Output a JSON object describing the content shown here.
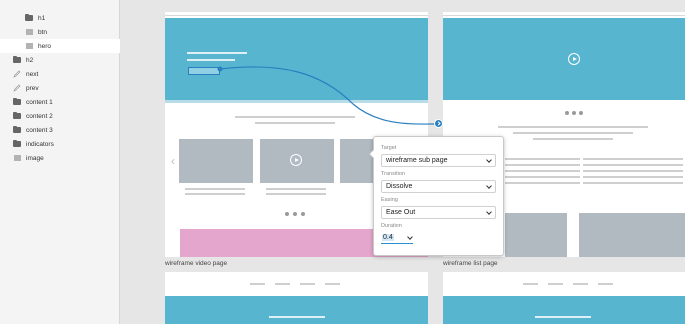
{
  "layers": [
    {
      "label": "h1",
      "icon": "folder-icon"
    },
    {
      "label": "btn",
      "icon": "rectangle-icon"
    },
    {
      "label": "hero",
      "icon": "rectangle-icon",
      "selected": true
    },
    {
      "label": "h2",
      "icon": "folder-icon"
    },
    {
      "label": "next",
      "icon": "pen-icon"
    },
    {
      "label": "prev",
      "icon": "pen-icon"
    },
    {
      "label": "content 1",
      "icon": "folder-icon"
    },
    {
      "label": "content 2",
      "icon": "folder-icon"
    },
    {
      "label": "content 3",
      "icon": "folder-icon"
    },
    {
      "label": "indicators",
      "icon": "folder-icon"
    },
    {
      "label": "image",
      "icon": "rectangle-icon"
    }
  ],
  "artboards": {
    "video_label": "wireframe video page",
    "list_label": "wireframe list page",
    "prev_arrow": "‹"
  },
  "popover": {
    "target_label": "Target",
    "target_value": "wireframe sub page",
    "transition_label": "Transition",
    "transition_value": "Dissolve",
    "easing_label": "Easing",
    "easing_value": "Ease Out",
    "duration_label": "Duration",
    "duration_value": "0.4"
  },
  "colors": {
    "hero_blue": "#57b5cf",
    "link_blue": "#2a7fc0",
    "pink_block": "#e4a6cc",
    "thumb_gray": "#b1bac1"
  }
}
